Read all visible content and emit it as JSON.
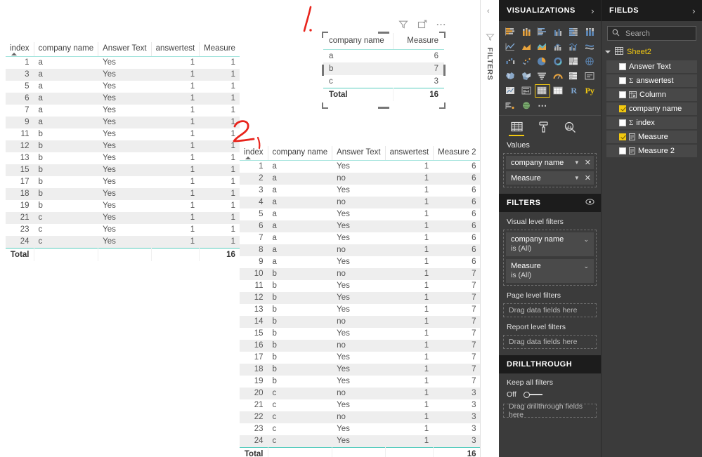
{
  "canvas": {
    "table1": {
      "name": "table-visual-1",
      "columns": [
        "index",
        "company name",
        "Answer Text",
        "answertest",
        "Measure"
      ],
      "column_align": [
        "num",
        "txt",
        "txt",
        "num",
        "num"
      ],
      "sorted_column": "index",
      "rows": [
        [
          "1",
          "a",
          "Yes",
          "1",
          "1"
        ],
        [
          "3",
          "a",
          "Yes",
          "1",
          "1"
        ],
        [
          "5",
          "a",
          "Yes",
          "1",
          "1"
        ],
        [
          "6",
          "a",
          "Yes",
          "1",
          "1"
        ],
        [
          "7",
          "a",
          "Yes",
          "1",
          "1"
        ],
        [
          "9",
          "a",
          "Yes",
          "1",
          "1"
        ],
        [
          "11",
          "b",
          "Yes",
          "1",
          "1"
        ],
        [
          "12",
          "b",
          "Yes",
          "1",
          "1"
        ],
        [
          "13",
          "b",
          "Yes",
          "1",
          "1"
        ],
        [
          "15",
          "b",
          "Yes",
          "1",
          "1"
        ],
        [
          "17",
          "b",
          "Yes",
          "1",
          "1"
        ],
        [
          "18",
          "b",
          "Yes",
          "1",
          "1"
        ],
        [
          "19",
          "b",
          "Yes",
          "1",
          "1"
        ],
        [
          "21",
          "c",
          "Yes",
          "1",
          "1"
        ],
        [
          "23",
          "c",
          "Yes",
          "1",
          "1"
        ],
        [
          "24",
          "c",
          "Yes",
          "1",
          "1"
        ]
      ],
      "total_row": [
        "Total",
        "",
        "",
        "",
        "16"
      ]
    },
    "matrix": {
      "name": "matrix-visual",
      "columns": [
        "company name",
        "Measure"
      ],
      "column_align": [
        "txt",
        "num"
      ],
      "rows": [
        [
          "a",
          "6"
        ],
        [
          "b",
          "7"
        ],
        [
          "c",
          "3"
        ]
      ],
      "highlighted_row_index": 1,
      "total_row": [
        "Total",
        "16"
      ],
      "header_icons": [
        "filter-icon",
        "focus-mode-icon",
        "more-options-icon"
      ]
    },
    "table2": {
      "name": "table-visual-2",
      "columns": [
        "index",
        "company name",
        "Answer Text",
        "answertest",
        "Measure 2"
      ],
      "column_align": [
        "num",
        "txt",
        "txt",
        "num",
        "num"
      ],
      "sorted_column": "index",
      "rows": [
        [
          "1",
          "a",
          "Yes",
          "1",
          "6"
        ],
        [
          "2",
          "a",
          "no",
          "1",
          "6"
        ],
        [
          "3",
          "a",
          "Yes",
          "1",
          "6"
        ],
        [
          "4",
          "a",
          "no",
          "1",
          "6"
        ],
        [
          "5",
          "a",
          "Yes",
          "1",
          "6"
        ],
        [
          "6",
          "a",
          "Yes",
          "1",
          "6"
        ],
        [
          "7",
          "a",
          "Yes",
          "1",
          "6"
        ],
        [
          "8",
          "a",
          "no",
          "1",
          "6"
        ],
        [
          "9",
          "a",
          "Yes",
          "1",
          "6"
        ],
        [
          "10",
          "b",
          "no",
          "1",
          "7"
        ],
        [
          "11",
          "b",
          "Yes",
          "1",
          "7"
        ],
        [
          "12",
          "b",
          "Yes",
          "1",
          "7"
        ],
        [
          "13",
          "b",
          "Yes",
          "1",
          "7"
        ],
        [
          "14",
          "b",
          "no",
          "1",
          "7"
        ],
        [
          "15",
          "b",
          "Yes",
          "1",
          "7"
        ],
        [
          "16",
          "b",
          "no",
          "1",
          "7"
        ],
        [
          "17",
          "b",
          "Yes",
          "1",
          "7"
        ],
        [
          "18",
          "b",
          "Yes",
          "1",
          "7"
        ],
        [
          "19",
          "b",
          "Yes",
          "1",
          "7"
        ],
        [
          "20",
          "c",
          "no",
          "1",
          "3"
        ],
        [
          "21",
          "c",
          "Yes",
          "1",
          "3"
        ],
        [
          "22",
          "c",
          "no",
          "1",
          "3"
        ],
        [
          "23",
          "c",
          "Yes",
          "1",
          "3"
        ],
        [
          "24",
          "c",
          "Yes",
          "1",
          "3"
        ]
      ],
      "total_row": [
        "Total",
        "",
        "",
        "",
        "16"
      ]
    },
    "annotations": [
      {
        "id": "annotation-1",
        "text": "1.",
        "color": "#e8241c"
      },
      {
        "id": "annotation-2",
        "text": "2.",
        "color": "#e8241c"
      }
    ]
  },
  "filters_strip": {
    "label": "FILTERS",
    "collapse_chevron": "‹",
    "funnel_icon": "funnel-icon"
  },
  "visualizations": {
    "title": "VISUALIZATIONS",
    "expand_chevron": "›",
    "gallery": [
      {
        "name": "stacked-bar-chart"
      },
      {
        "name": "stacked-column-chart"
      },
      {
        "name": "clustered-bar-chart"
      },
      {
        "name": "clustered-column-chart"
      },
      {
        "name": "100-percent-stacked-bar-chart"
      },
      {
        "name": "100-percent-stacked-column-chart"
      },
      {
        "name": "line-chart"
      },
      {
        "name": "area-chart"
      },
      {
        "name": "stacked-area-chart"
      },
      {
        "name": "line-and-stacked-column-chart"
      },
      {
        "name": "line-and-clustered-column-chart"
      },
      {
        "name": "ribbon-chart"
      },
      {
        "name": "waterfall-chart"
      },
      {
        "name": "scatter-chart"
      },
      {
        "name": "pie-chart"
      },
      {
        "name": "donut-chart"
      },
      {
        "name": "treemap"
      },
      {
        "name": "map"
      },
      {
        "name": "filled-map"
      },
      {
        "name": "shape-map"
      },
      {
        "name": "funnel-chart"
      },
      {
        "name": "gauge-chart"
      },
      {
        "name": "multi-row-card"
      },
      {
        "name": "card"
      },
      {
        "name": "kpi"
      },
      {
        "name": "slicer"
      },
      {
        "name": "table",
        "selected": true
      },
      {
        "name": "matrix"
      },
      {
        "name": "r-script-visual",
        "glyph": "R"
      },
      {
        "name": "python-visual",
        "glyph": "Py"
      },
      {
        "name": "key-influencers"
      },
      {
        "name": "arcgis-maps"
      },
      {
        "name": "get-more-visuals",
        "glyph": "⋯"
      }
    ],
    "tabs": [
      {
        "name": "fields-tab",
        "icon": "fields-grid-icon",
        "active": true
      },
      {
        "name": "format-tab",
        "icon": "paint-roller-icon",
        "active": false
      },
      {
        "name": "analytics-tab",
        "icon": "magnifier-analytics-icon",
        "active": false
      }
    ],
    "values_well": {
      "label": "Values",
      "items": [
        {
          "label": "company name"
        },
        {
          "label": "Measure"
        }
      ]
    },
    "filters": {
      "title": "FILTERS",
      "eye_icon": "eye-icon",
      "visual_level": {
        "label": "Visual level filters",
        "cards": [
          {
            "name": "company name",
            "condition": "is (All)"
          },
          {
            "name": "Measure",
            "condition": "is (All)"
          }
        ]
      },
      "page_level": {
        "label": "Page level filters",
        "dropzone": "Drag data fields here"
      },
      "report_level": {
        "label": "Report level filters",
        "dropzone": "Drag data fields here"
      }
    },
    "drillthrough": {
      "title": "DRILLTHROUGH",
      "keep_all_filters_label": "Keep all filters",
      "toggle_state": "Off",
      "dropzone": "Drag drillthrough fields here"
    }
  },
  "fields": {
    "title": "FIELDS",
    "expand_chevron": "›",
    "search": {
      "placeholder": "Search",
      "value": "",
      "icon": "search-icon"
    },
    "table": {
      "name": "Sheet2",
      "icon": "table-icon",
      "expanded": true,
      "items": [
        {
          "label": "Answer Text",
          "checked": false,
          "icon": "none"
        },
        {
          "label": "answertest",
          "checked": false,
          "icon": "sigma"
        },
        {
          "label": "Column",
          "checked": false,
          "icon": "calculated-column-icon"
        },
        {
          "label": "company name",
          "checked": true,
          "icon": "none"
        },
        {
          "label": "index",
          "checked": false,
          "icon": "sigma"
        },
        {
          "label": "Measure",
          "checked": true,
          "icon": "measure-icon"
        },
        {
          "label": "Measure 2",
          "checked": false,
          "icon": "measure-icon"
        }
      ]
    }
  }
}
